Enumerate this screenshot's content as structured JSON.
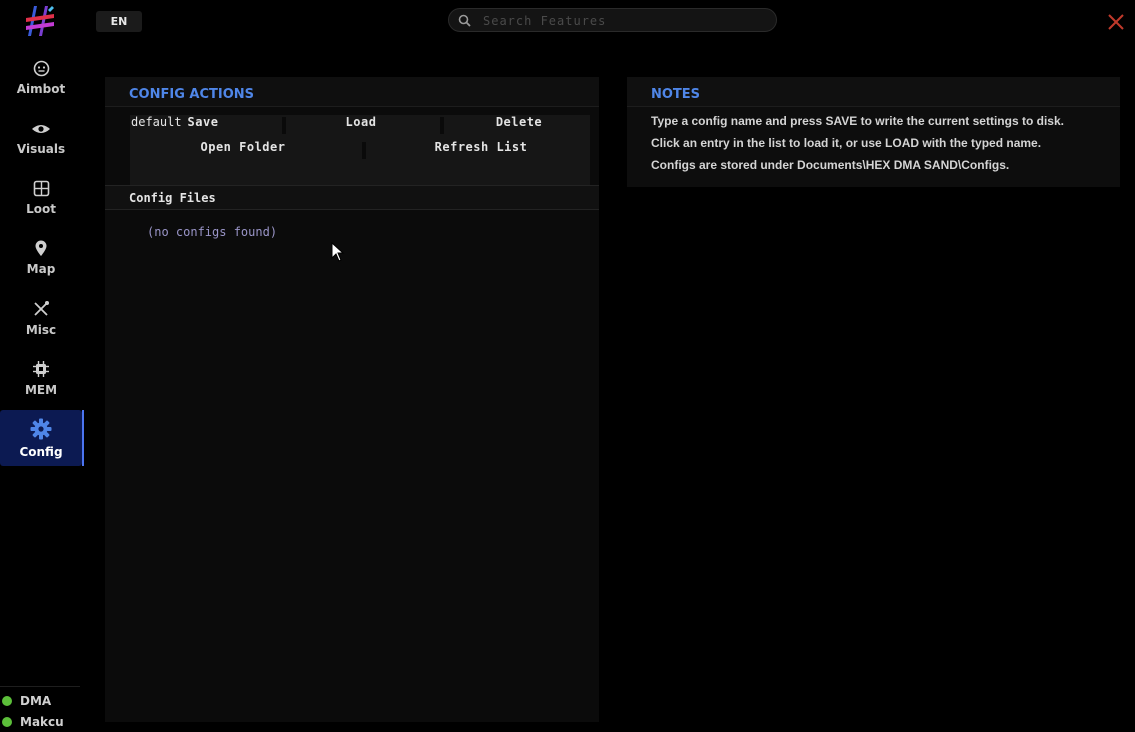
{
  "header": {
    "language": "EN",
    "search_placeholder": "Search Features"
  },
  "sidebar": {
    "items": [
      {
        "label": "Aimbot",
        "icon": "aimbot-face-icon"
      },
      {
        "label": "Visuals",
        "icon": "eye-icon"
      },
      {
        "label": "Loot",
        "icon": "box-icon"
      },
      {
        "label": "Map",
        "icon": "map-pin-icon"
      },
      {
        "label": "Misc",
        "icon": "tools-icon"
      },
      {
        "label": "MEM",
        "icon": "chip-icon"
      },
      {
        "label": "Config",
        "icon": "gear-icon",
        "active": true
      }
    ],
    "status": [
      {
        "label": "DMA",
        "color": "#5cbf3a"
      },
      {
        "label": "Makcu",
        "color": "#5cbf3a"
      }
    ]
  },
  "config_actions": {
    "title": "CONFIG ACTIONS",
    "config_name": "default",
    "buttons": {
      "save": "Save",
      "load": "Load",
      "delete": "Delete",
      "open_folder": "Open Folder",
      "refresh_list": "Refresh List"
    },
    "files_title": "Config Files",
    "empty_text": "(no configs found)"
  },
  "notes": {
    "title": "NOTES",
    "lines": [
      "Type a config name and press SAVE to write the current settings to disk.",
      "Click an entry in the list to load it, or use LOAD with the typed name.",
      "Configs are stored under Documents\\HEX DMA SAND\\Configs."
    ]
  },
  "colors": {
    "accent": "#4f86e8",
    "active_nav": "#0c1a52",
    "close": "#c0392b",
    "status_ok": "#5cbf3a"
  }
}
